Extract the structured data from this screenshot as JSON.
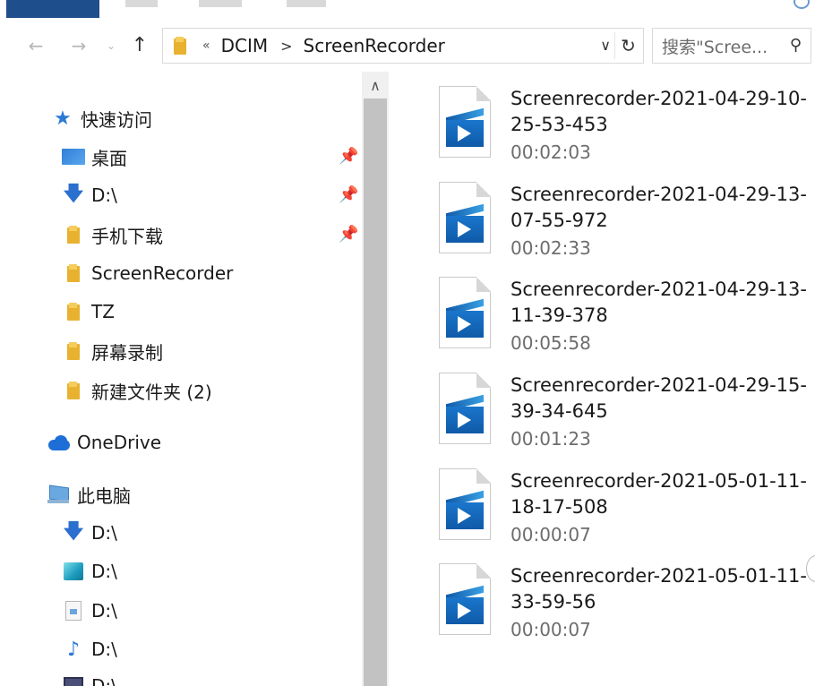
{
  "address": {
    "overflow": "«",
    "crumbs": [
      "DCIM",
      "ScreenRecorder"
    ],
    "separator": ">"
  },
  "search": {
    "placeholder": "搜索\"Scree..."
  },
  "sidebar": {
    "quick_access": "快速访问",
    "items": [
      {
        "label": "桌面",
        "icon": "desktop-icon",
        "pinned": true
      },
      {
        "label": "D:\\",
        "icon": "download-arrow-icon",
        "pinned": true
      },
      {
        "label": "手机下载",
        "icon": "folder-icon",
        "pinned": true
      },
      {
        "label": "ScreenRecorder",
        "icon": "folder-icon",
        "pinned": false
      },
      {
        "label": "TZ",
        "icon": "folder-icon",
        "pinned": false
      },
      {
        "label": "屏幕录制",
        "icon": "folder-icon",
        "pinned": false
      },
      {
        "label": "新建文件夹 (2)",
        "icon": "folder-icon",
        "pinned": false
      }
    ],
    "onedrive": "OneDrive",
    "this_pc": "此电脑",
    "pc_items": [
      {
        "label": "D:\\",
        "icon": "download-arrow-icon"
      },
      {
        "label": "D:\\",
        "icon": "3d-objects-icon"
      },
      {
        "label": "D:\\",
        "icon": "document-icon"
      },
      {
        "label": "D:\\",
        "icon": "music-note-icon"
      },
      {
        "label": "D:\\",
        "icon": "video-icon"
      }
    ]
  },
  "files": [
    {
      "name": "Screenrecorder-2021-04-29-10-25-53-453",
      "duration": "00:02:03"
    },
    {
      "name": "Screenrecorder-2021-04-29-13-07-55-972",
      "duration": "00:02:33"
    },
    {
      "name": "Screenrecorder-2021-04-29-13-11-39-378",
      "duration": "00:05:58"
    },
    {
      "name": "Screenrecorder-2021-04-29-15-39-34-645",
      "duration": "00:01:23"
    },
    {
      "name": "Screenrecorder-2021-05-01-11-18-17-508",
      "duration": "00:00:07"
    },
    {
      "name": "Screenrecorder-2021-05-01-11-33-59-56",
      "duration": "00:00:07"
    }
  ],
  "colors": {
    "accent": "#2b78d6",
    "folder": "#e8b230",
    "scroll_thumb": "#c2c2c2"
  }
}
